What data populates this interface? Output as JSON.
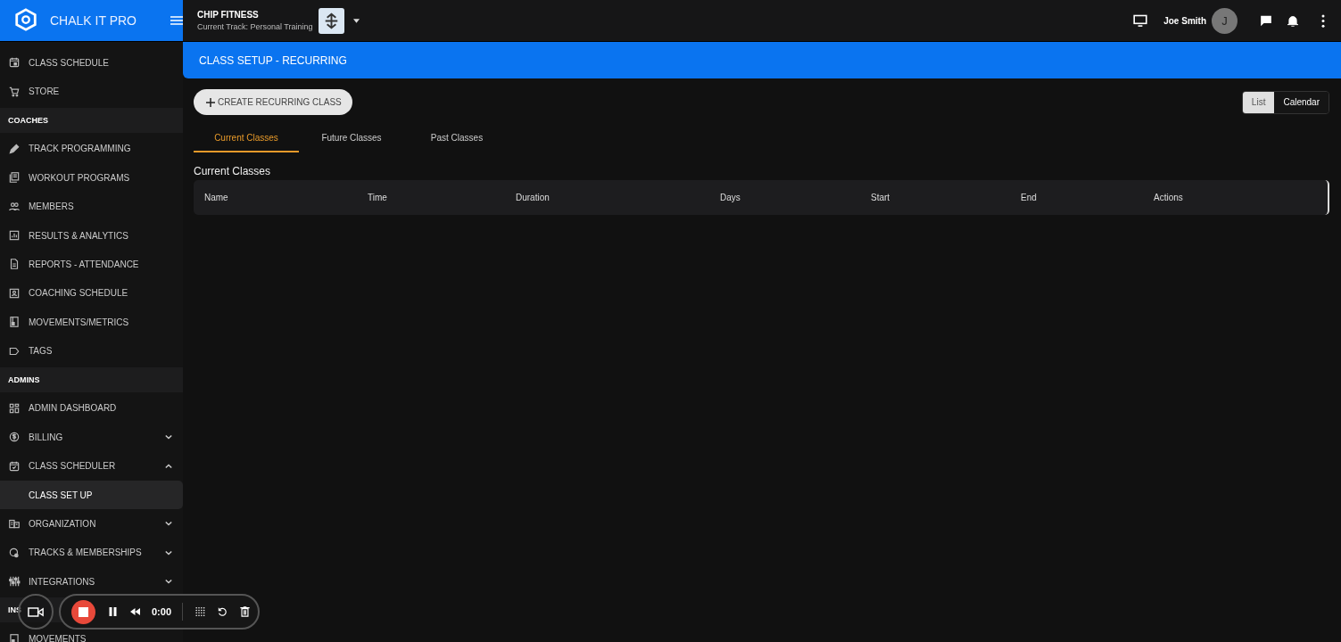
{
  "brand": {
    "name": "CHALK IT PRO"
  },
  "gym": {
    "name": "CHIP FITNESS",
    "track": "Current Track: Personal Training"
  },
  "user": {
    "name": "Joe Smith",
    "initial": "J"
  },
  "sidebar": {
    "items": [
      {
        "kind": "item",
        "label": "CLASS SCHEDULE",
        "selected": false
      },
      {
        "kind": "item",
        "label": "STORE",
        "selected": false
      },
      {
        "kind": "section",
        "label": "COACHES"
      },
      {
        "kind": "item",
        "label": "TRACK PROGRAMMING",
        "selected": false
      },
      {
        "kind": "item",
        "label": "WORKOUT PROGRAMS",
        "selected": false
      },
      {
        "kind": "item",
        "label": "MEMBERS",
        "selected": false
      },
      {
        "kind": "item",
        "label": "RESULTS & ANALYTICS",
        "selected": false
      },
      {
        "kind": "item",
        "label": "REPORTS - ATTENDANCE",
        "selected": false
      },
      {
        "kind": "item",
        "label": "COACHING SCHEDULE",
        "selected": false
      },
      {
        "kind": "item",
        "label": "MOVEMENTS/METRICS",
        "selected": false
      },
      {
        "kind": "item",
        "label": "TAGS",
        "selected": false
      },
      {
        "kind": "section",
        "label": "ADMINS"
      },
      {
        "kind": "item",
        "label": "ADMIN DASHBOARD",
        "selected": false
      },
      {
        "kind": "item",
        "label": "BILLING",
        "selected": false,
        "expanded": false
      },
      {
        "kind": "item",
        "label": "CLASS SCHEDULER",
        "selected": false,
        "expanded": true,
        "children": [
          {
            "kind": "item",
            "label": "CLASS SET UP",
            "selected": true
          }
        ]
      },
      {
        "kind": "item",
        "label": "ORGANIZATION",
        "selected": false,
        "expanded": false
      },
      {
        "kind": "item",
        "label": "TRACKS & MEMBERSHIPS",
        "selected": false,
        "expanded": false
      },
      {
        "kind": "item",
        "label": "INTEGRATIONS",
        "selected": false,
        "expanded": false
      },
      {
        "kind": "section",
        "label": "INS"
      },
      {
        "kind": "item",
        "label": "MOVEMENTS",
        "selected": false
      }
    ]
  },
  "page": {
    "title": "CLASS SETUP - RECURRING"
  },
  "create_button": {
    "label": "CREATE RECURRING CLASS"
  },
  "view_toggle": [
    {
      "label": "List",
      "selected": true
    },
    {
      "label": "Calendar",
      "selected": false
    }
  ],
  "tabs": [
    {
      "label": "Current Classes",
      "selected": true
    },
    {
      "label": "Future Classes",
      "selected": false
    },
    {
      "label": "Past Classes",
      "selected": false
    }
  ],
  "table": {
    "title": "Current Classes",
    "columns": [
      "Name",
      "Time",
      "Duration",
      "Days",
      "Start",
      "End",
      "Actions"
    ]
  },
  "recorder": {
    "time": "0:00"
  }
}
